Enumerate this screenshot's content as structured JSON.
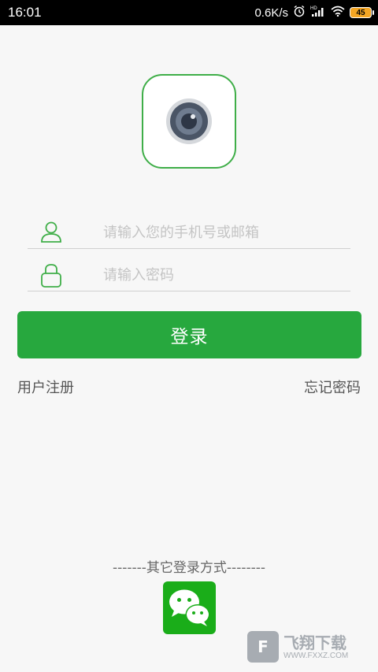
{
  "status_bar": {
    "time": "16:01",
    "network_speed": "0.6K/s",
    "battery_level": "45",
    "icons": [
      "alarm-icon",
      "hd-signal-icon",
      "wifi-icon",
      "battery-icon"
    ]
  },
  "logo": {
    "icon": "camera-icon",
    "border_color": "#3fae48"
  },
  "login_form": {
    "username_placeholder": "请输入您的手机号或邮箱",
    "password_placeholder": "请输入密码",
    "username_icon": "user-icon",
    "password_icon": "lock-icon",
    "submit_label": "登录",
    "submit_color": "#27a83e"
  },
  "links": {
    "register": "用户注册",
    "forgot_password": "忘记密码"
  },
  "other_login": {
    "label": "-------其它登录方式--------",
    "wechat_icon": "wechat-icon",
    "wechat_color": "#1aad19"
  },
  "watermark": {
    "title": "飞翔下载",
    "url": "WWW.FXXZ.COM"
  }
}
